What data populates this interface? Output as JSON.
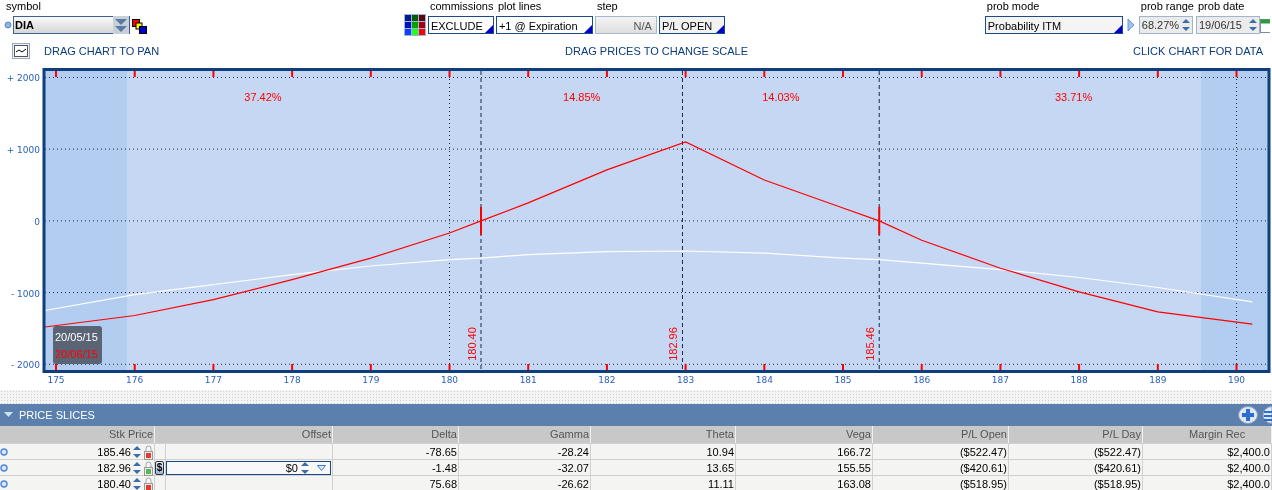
{
  "toolbar": {
    "symbol": {
      "label": "symbol",
      "value": "DIA"
    },
    "commissions": {
      "label": "commissions",
      "value": "EXCLUDE"
    },
    "plot_lines": {
      "label": "plot lines",
      "value": "+1 @ Expiration"
    },
    "step": {
      "label": "step",
      "value": "N/A",
      "disabled": true
    },
    "pl_mode": {
      "value": "P/L OPEN"
    },
    "prob_mode": {
      "label": "prob mode",
      "value": "Probability ITM"
    },
    "prob_range": {
      "label": "prob range",
      "value": "68.27%"
    },
    "prob_date": {
      "label": "prob date",
      "value": "19/06/15"
    }
  },
  "hints": [
    "DRAG CHART TO PAN",
    "DRAG PRICES TO CHANGE SCALE",
    "CLICK CHART FOR DATA"
  ],
  "chart": {
    "chart_data": {
      "type": "line",
      "x": [
        174.86,
        176,
        177,
        178,
        179,
        180,
        180.4,
        181,
        182,
        183,
        184,
        185,
        185.46,
        186,
        187,
        188,
        189,
        190.2
      ],
      "series": [
        {
          "name": "20/05/15",
          "color": "#ffffff",
          "values": [
            -1250,
            -1030,
            -890,
            -750,
            -630,
            -540,
            -520,
            -470,
            -430,
            -420,
            -450,
            -520,
            -540,
            -590,
            -680,
            -790,
            -930,
            -1130
          ]
        },
        {
          "name": "20/06/15",
          "color": "#ff0000",
          "values": [
            -1480,
            -1320,
            -1100,
            -820,
            -520,
            -170,
            0,
            250,
            710,
            1100,
            570,
            180,
            0,
            -270,
            -660,
            -990,
            -1270,
            -1440
          ]
        }
      ],
      "xlim": [
        174.86,
        190.4
      ],
      "ylim": [
        -2080,
        2090
      ],
      "grid": true,
      "ref_lines": [
        {
          "axis": "x",
          "value": 180.4,
          "label": "180.40"
        },
        {
          "axis": "x",
          "value": 182.96,
          "label": "182.96"
        },
        {
          "axis": "x",
          "value": 185.46,
          "label": "185.46"
        }
      ],
      "xticks": [
        175,
        176,
        177,
        178,
        179,
        180,
        181,
        182,
        183,
        184,
        185,
        186,
        187,
        188,
        189,
        190
      ],
      "yticks": [
        {
          "value": 2000,
          "label": "+ 2000"
        },
        {
          "value": 1000,
          "label": "+ 1000"
        },
        {
          "value": 0,
          "label": "0"
        },
        {
          "value": -1000,
          "label": "- 1000"
        },
        {
          "value": -2000,
          "label": "- 2000"
        }
      ],
      "annotations": [
        "37.42%",
        "14.85%",
        "14.03%",
        "33.71%"
      ]
    }
  },
  "price_slices": {
    "title": "PRICE SLICES",
    "expanded": true,
    "columns": [
      "Stk Price",
      "Offset",
      "Delta",
      "Gamma",
      "Theta",
      "Vega",
      "P/L Open",
      "P/L Day",
      "Margin Rec"
    ],
    "rows": [
      {
        "selected": false,
        "locked": true,
        "cells": [
          "185.46",
          "",
          "-78.65",
          "-28.24",
          "10.94",
          "166.72",
          "($522.47)",
          "($522.47)",
          "$2,400.0"
        ]
      },
      {
        "selected": true,
        "locked": false,
        "offset_unit": "$",
        "cells": [
          "182.96",
          "$0",
          "-1.48",
          "-32.07",
          "13.65",
          "155.55",
          "($420.61)",
          "($420.61)",
          "$2,400.0"
        ]
      },
      {
        "selected": false,
        "locked": true,
        "cells": [
          "180.40",
          "",
          "75.68",
          "-26.62",
          "11.11",
          "163.08",
          "($518.95)",
          "($518.95)",
          "$2,400.0"
        ]
      }
    ]
  }
}
